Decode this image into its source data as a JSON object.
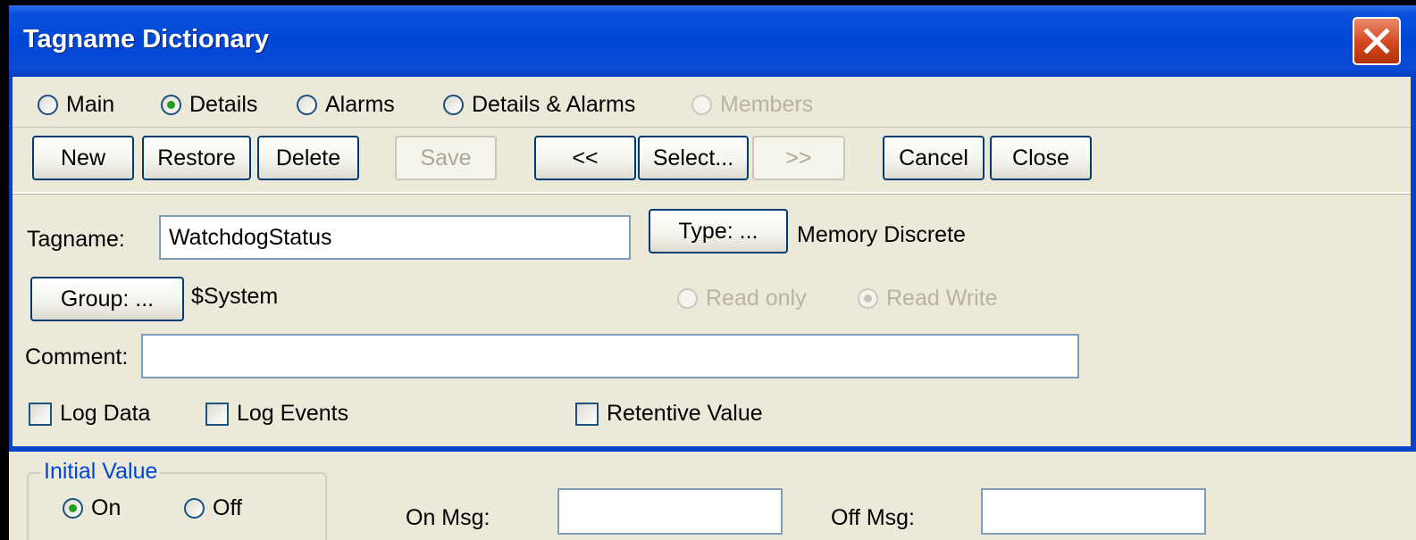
{
  "window": {
    "title": "Tagname Dictionary"
  },
  "view_options": [
    {
      "label": "Main",
      "checked": false,
      "disabled": false
    },
    {
      "label": "Details",
      "checked": true,
      "disabled": false
    },
    {
      "label": "Alarms",
      "checked": false,
      "disabled": false
    },
    {
      "label": "Details & Alarms",
      "checked": false,
      "disabled": false
    },
    {
      "label": "Members",
      "checked": false,
      "disabled": true
    }
  ],
  "toolbar": {
    "new": "New",
    "restore": "Restore",
    "delete": "Delete",
    "save": "Save",
    "prev": "<<",
    "select": "Select...",
    "next": ">>",
    "cancel": "Cancel",
    "close": "Close"
  },
  "details": {
    "tagname_label": "Tagname:",
    "tagname_value": "WatchdogStatus",
    "type_button": "Type: ...",
    "type_value": "Memory Discrete",
    "group_button": "Group: ...",
    "group_value": "$System",
    "access": {
      "read_only": "Read only",
      "read_write": "Read Write",
      "selected": "Read Write"
    },
    "comment_label": "Comment:",
    "comment_value": "",
    "log_data": "Log Data",
    "log_events": "Log Events",
    "retentive_value": "Retentive Value"
  },
  "initial_value": {
    "title": "Initial Value",
    "on": "On",
    "off": "Off",
    "selected": "On",
    "on_msg_label": "On Msg:",
    "on_msg_value": "",
    "off_msg_label": "Off Msg:",
    "off_msg_value": ""
  },
  "colors": {
    "title_bar": "#0046d6",
    "face": "#ece9d8",
    "accent_text": "#0046d5",
    "close_button": "#d2471f"
  }
}
